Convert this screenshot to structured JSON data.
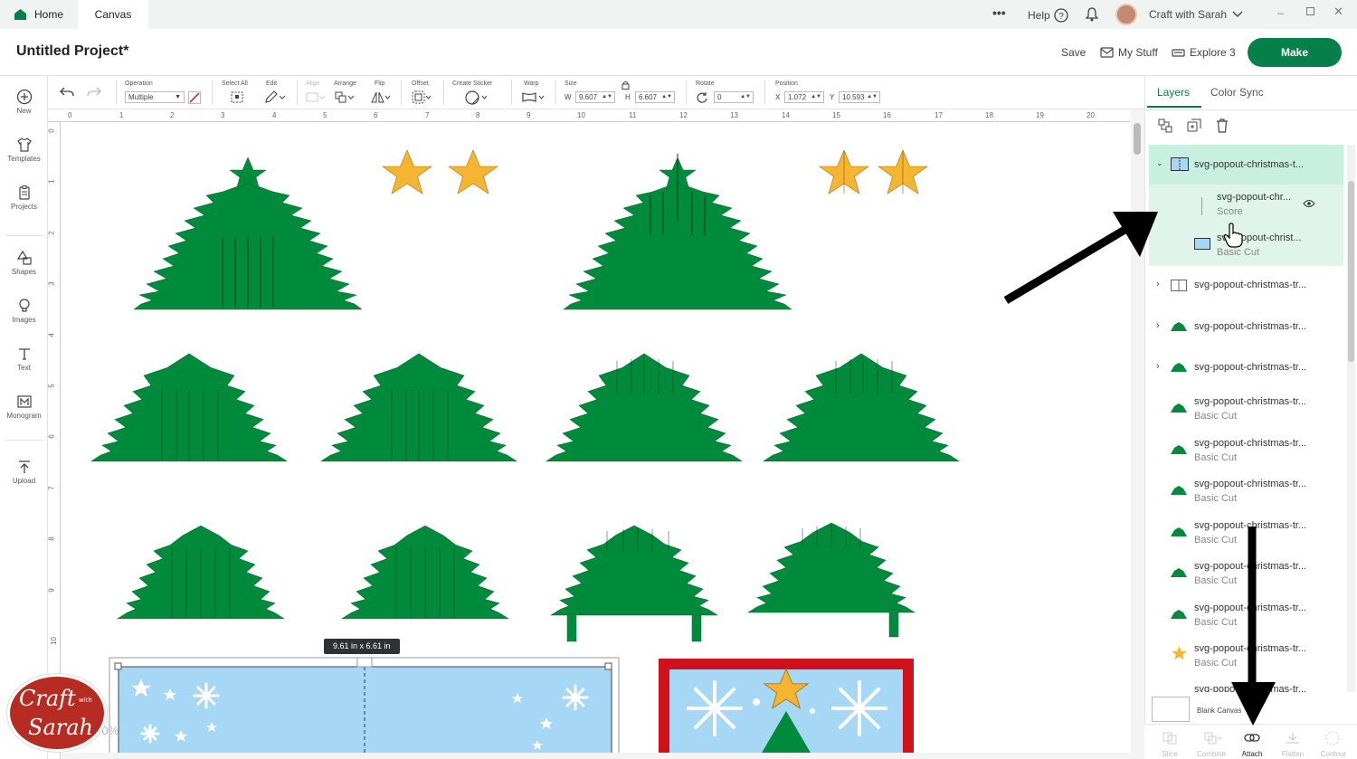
{
  "tabs": {
    "home": "Home",
    "canvas": "Canvas"
  },
  "titlebar": {
    "help": "Help",
    "account": "Craft with Sarah"
  },
  "header": {
    "title": "Untitled Project*",
    "save": "Save",
    "my_stuff": "My Stuff",
    "machine": "Explore 3",
    "make": "Make"
  },
  "sidebar": {
    "items": [
      {
        "label": "New",
        "icon": "plus-circle-icon"
      },
      {
        "label": "Templates",
        "icon": "shirt-icon"
      },
      {
        "label": "Projects",
        "icon": "clipboard-icon"
      },
      {
        "label": "Shapes",
        "icon": "shapes-icon"
      },
      {
        "label": "Images",
        "icon": "bulb-icon"
      },
      {
        "label": "Text",
        "icon": "text-icon"
      },
      {
        "label": "Monogram",
        "icon": "monogram-icon"
      },
      {
        "label": "Upload",
        "icon": "upload-icon"
      }
    ]
  },
  "toolbar": {
    "operation_label": "Operation",
    "operation_value": "Multiple",
    "select_all": "Select All",
    "edit": "Edit",
    "align": "Align",
    "arrange": "Arrange",
    "flip": "Flip",
    "offset": "Offset",
    "create_sticker": "Create Sticker",
    "warp": "Warp",
    "size": "Size",
    "w_label": "W",
    "w_value": "9.607",
    "h_label": "H",
    "h_value": "6.607",
    "rotate": "Rotate",
    "rotate_value": "0",
    "position": "Position",
    "x_label": "X",
    "x_value": "1.072",
    "y_label": "Y",
    "y_value": "10.593"
  },
  "ruler": {
    "top": [
      "0",
      "1",
      "2",
      "3",
      "4",
      "5",
      "6",
      "7",
      "8",
      "9",
      "10",
      "11",
      "12",
      "13",
      "14",
      "15",
      "16",
      "17",
      "18",
      "19",
      "20"
    ],
    "left": [
      "0",
      "1",
      "2",
      "3",
      "4",
      "5",
      "6",
      "7",
      "8",
      "9",
      "10"
    ]
  },
  "canvas": {
    "size_tooltip": "9.61  in x 6.61  in",
    "zoom": "100%"
  },
  "panel": {
    "tabs": [
      "Layers",
      "Color Sync"
    ],
    "layers": [
      {
        "name": "svg-popout-christmas-t...",
        "type": "",
        "kind": "group-open"
      },
      {
        "name": "svg-popout-chr...",
        "type": "Score",
        "kind": "child"
      },
      {
        "name": "svg-popout-christ...",
        "type": "Basic Cut",
        "kind": "child"
      },
      {
        "name": "svg-popout-christmas-tr...",
        "type": "",
        "kind": "group"
      },
      {
        "name": "svg-popout-christmas-tr...",
        "type": "",
        "kind": "group"
      },
      {
        "name": "svg-popout-christmas-tr...",
        "type": "",
        "kind": "group"
      },
      {
        "name": "svg-popout-christmas-tr...",
        "type": "Basic Cut",
        "kind": "item"
      },
      {
        "name": "svg-popout-christmas-tr...",
        "type": "Basic Cut",
        "kind": "item"
      },
      {
        "name": "svg-popout-christmas-tr...",
        "type": "Basic Cut",
        "kind": "item"
      },
      {
        "name": "svg-popout-christmas-tr...",
        "type": "Basic Cut",
        "kind": "item"
      },
      {
        "name": "svg-popout-christmas-tr...",
        "type": "Basic Cut",
        "kind": "item"
      },
      {
        "name": "svg-popout-christmas-tr...",
        "type": "Basic Cut",
        "kind": "item"
      },
      {
        "name": "svg-popout-christmas-tr...",
        "type": "Basic Cut",
        "kind": "item"
      },
      {
        "name": "svg-popout-christmas-tr...",
        "type": "",
        "kind": "item"
      }
    ],
    "blank_canvas": "Blank Canvas",
    "bottom": [
      "Slice",
      "Combine",
      "Attach",
      "Flatten",
      "Contour"
    ]
  },
  "logo": {
    "text1": "Craft",
    "text2": "with",
    "text3": "Sarah"
  },
  "colors": {
    "brand_green": "#06804a",
    "tree_green": "#008a3c",
    "star_gold": "#f5b531",
    "card_blue": "#a6d8f5",
    "card_red": "#d0101a",
    "selection": "#c8f0e0"
  }
}
